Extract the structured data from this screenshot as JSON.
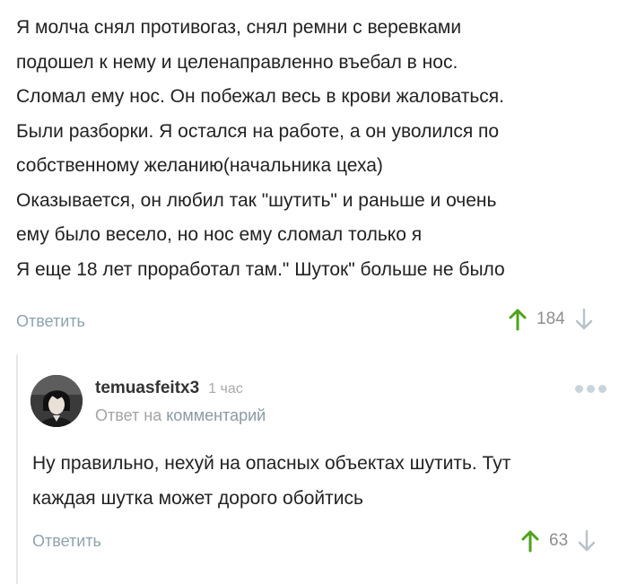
{
  "comment": {
    "lines": [
      " Я молча снял противогаз, снял ремни с веревками",
      "подошел к нему и целенаправленно въебал в нос.",
      "Сломал ему нос. Он побежал весь в крови жаловаться.",
      " Были разборки. Я остался на работе, а он уволился по",
      "собственному желанию(начальника цеха)",
      " Оказывается, он любил так \"шутить\" и раньше и очень",
      "ему было весело, но нос ему сломал только я",
      " Я еще 18 лет проработал там.\" Шуток\" больше не было"
    ],
    "reply_label": "Ответить",
    "rating": "184"
  },
  "reply": {
    "author": "temuasfeitx3",
    "time": "1 час",
    "reply_to_prefix": "Ответ на",
    "reply_to_target": "комментарий",
    "lines": [
      "Ну правильно, нехуй на опасных объектах шутить. Тут",
      "каждая шутка может дорого обойтись"
    ],
    "reply_label": "Ответить",
    "rating": "63"
  },
  "colors": {
    "upvote": "#4ea319",
    "downvote": "#b8c3c9",
    "link": "#8fa3ad"
  },
  "icons": {
    "upvote": "arrow-up-icon",
    "downvote": "arrow-down-icon",
    "more": "more-dots-icon"
  }
}
